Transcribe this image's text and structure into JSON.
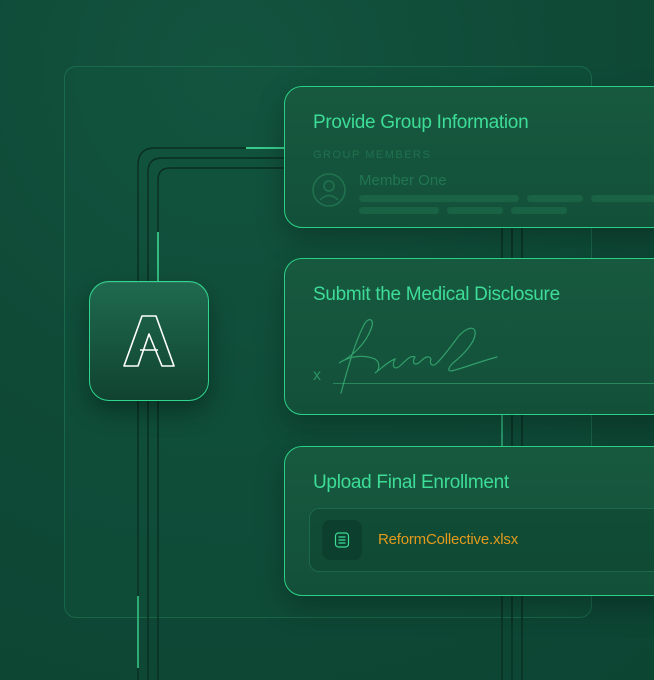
{
  "brand": {
    "logo_letter": "A",
    "accent_color": "#3ddc97",
    "background_color": "#0f4a37",
    "file_color": "#e39a1c"
  },
  "steps": [
    {
      "title": "Provide Group Information",
      "section_label": "GROUP MEMBERS",
      "member": {
        "name": "Member One",
        "avatar_icon": "user-avatar-icon"
      }
    },
    {
      "title": "Submit the Medical Disclosure",
      "signature_prefix": "x",
      "signature_icon": "signature-icon"
    },
    {
      "title": "Upload Final Enrollment",
      "file": {
        "name": "ReformCollective.xlsx",
        "icon": "document-icon"
      }
    }
  ]
}
